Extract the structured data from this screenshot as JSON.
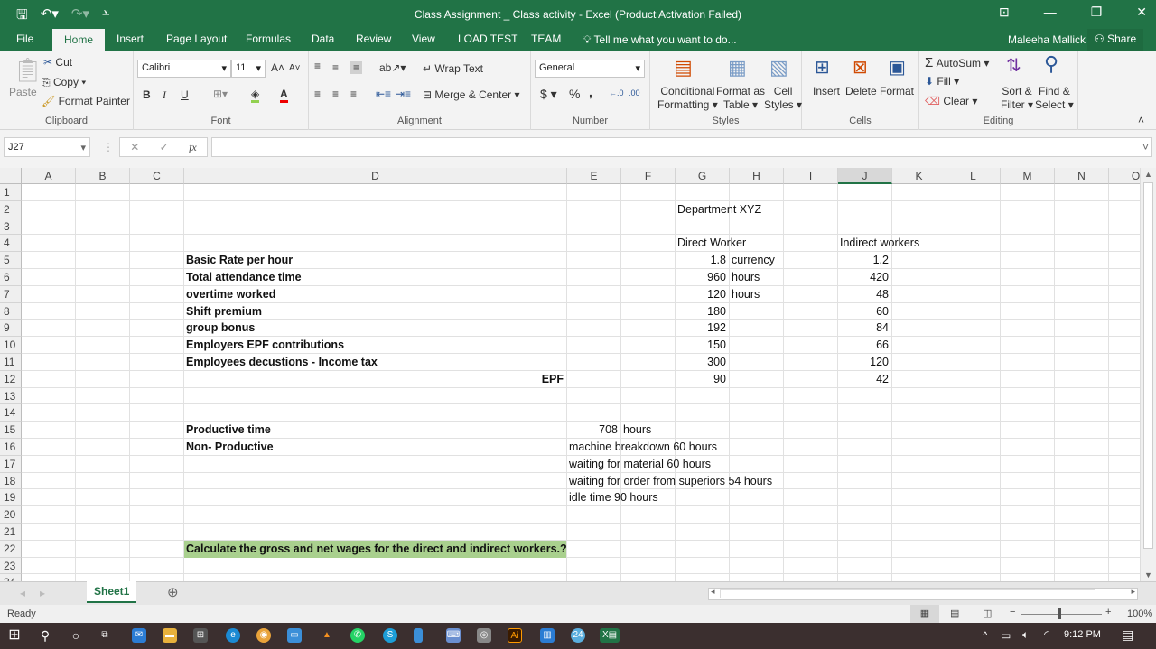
{
  "window": {
    "title": "Class Assignment _ Class activity - Excel (Product Activation Failed)"
  },
  "tabs": [
    "File",
    "Home",
    "Insert",
    "Page Layout",
    "Formulas",
    "Data",
    "Review",
    "View",
    "LOAD TEST",
    "TEAM"
  ],
  "tell_me": "Tell me what you want to do...",
  "user": "Maleeha Mallick",
  "share": "Share",
  "ribbon": {
    "clipboard": {
      "paste": "Paste",
      "cut": "Cut",
      "copy": "Copy",
      "format_painter": "Format Painter",
      "label": "Clipboard"
    },
    "font": {
      "name": "Calibri",
      "size": "11",
      "bold": "B",
      "italic": "I",
      "underline": "U",
      "label": "Font"
    },
    "alignment": {
      "wrap": "Wrap Text",
      "merge": "Merge & Center",
      "label": "Alignment"
    },
    "number": {
      "format": "General",
      "currency": "$",
      "percent": "%",
      "comma": ",",
      "label": "Number"
    },
    "styles": {
      "conditional": "Conditional",
      "conditional2": "Formatting",
      "format_table": "Format as",
      "format_table2": "Table",
      "cell_styles": "Cell",
      "cell_styles2": "Styles",
      "label": "Styles"
    },
    "cells": {
      "insert": "Insert",
      "delete": "Delete",
      "format": "Format",
      "label": "Cells"
    },
    "editing": {
      "autosum": "AutoSum",
      "fill": "Fill",
      "clear": "Clear",
      "sort": "Sort &",
      "sort2": "Filter",
      "find": "Find &",
      "find2": "Select",
      "label": "Editing"
    }
  },
  "name_box": "J27",
  "formula": "",
  "columns": [
    "A",
    "B",
    "C",
    "D",
    "E",
    "F",
    "G",
    "H",
    "I",
    "J",
    "K",
    "L",
    "M",
    "N",
    "O"
  ],
  "rows": [
    "1",
    "2",
    "3",
    "4",
    "5",
    "6",
    "7",
    "8",
    "9",
    "10",
    "11",
    "12",
    "13",
    "14",
    "15",
    "16",
    "17",
    "18",
    "19",
    "20",
    "21",
    "22",
    "23",
    "24"
  ],
  "cells": {
    "G2": "Department XYZ",
    "G4": "Direct Worker",
    "J4": "Indirect workers",
    "D5": "Basic Rate per hour",
    "G5": "1.8",
    "H5": "currency",
    "J5": "1.2",
    "D6": "Total attendance time",
    "G6": "960",
    "H6": "hours",
    "J6": "420",
    "D7": "overtime worked",
    "G7": "120",
    "H7": "hours",
    "J7": "48",
    "D8": "Shift premium",
    "G8": "180",
    "J8": "60",
    "D9": "group bonus",
    "G9": "192",
    "J9": "84",
    "D10": "Employers EPF contributions",
    "G10": "150",
    "J10": "66",
    "D11": "Employees decustions - Income tax",
    "G11": "300",
    "J11": "120",
    "D12": "EPF",
    "G12": "90",
    "J12": "42",
    "D15": "Productive time",
    "E15": "708",
    "F15": "hours",
    "D16": "Non- Productive",
    "E16": "machine breakdown 60 hours",
    "E17": "waiting for material 60  hours",
    "E18": "waiting for order from superiors 54 hours",
    "E19": "idle time 90 hours",
    "D22": "Calculate the gross and net wages for the direct and indirect workers.?"
  },
  "sheet_tab": "Sheet1",
  "status": {
    "ready": "Ready",
    "zoom": "100%"
  },
  "taskbar": {
    "time": "9:12 PM"
  },
  "colors": {
    "accent": "#217346",
    "highlight": "#a9d08e"
  }
}
